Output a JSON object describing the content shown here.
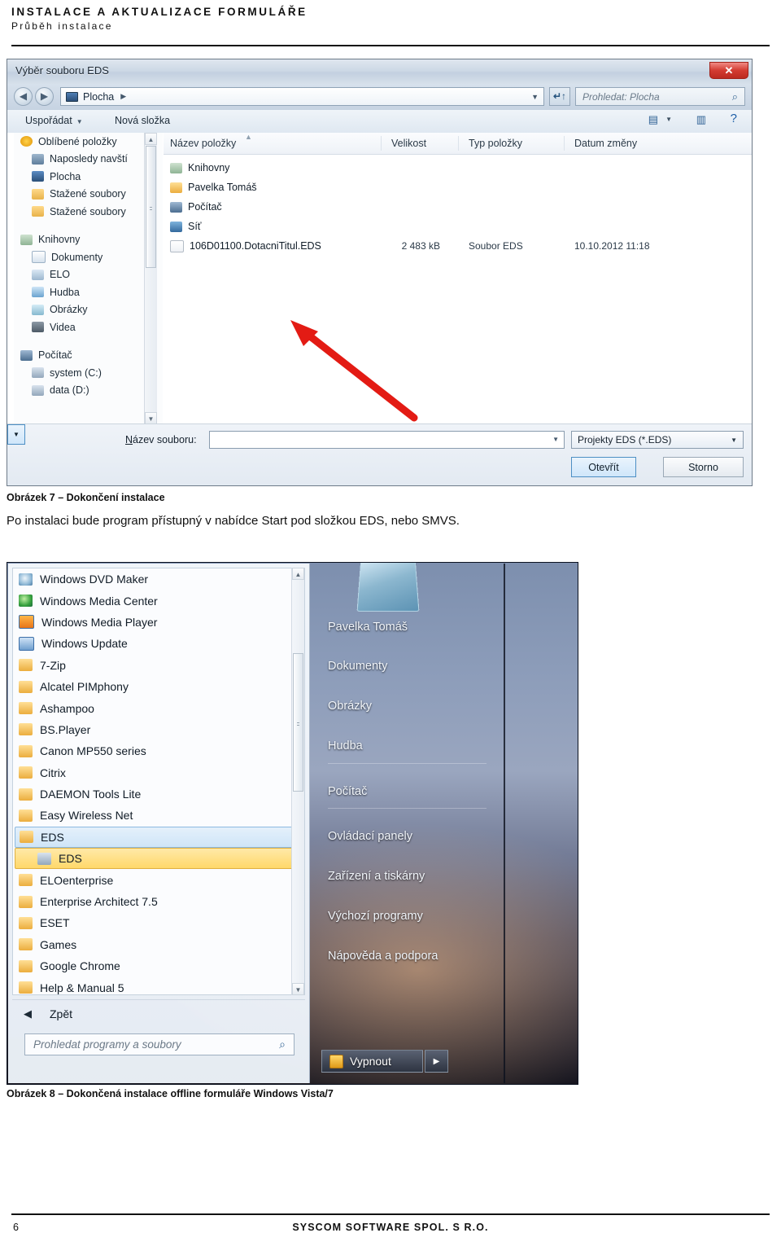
{
  "header": {
    "title": "INSTALACE A AKTUALIZACE FORMULÁŘE",
    "subtitle": "Průběh instalace"
  },
  "file_dialog": {
    "title": "Výběr souboru EDS",
    "close_label": "✕",
    "nav": {
      "back_icon": "◀",
      "forward_icon": "▶",
      "breadcrumb": "Plocha",
      "breadcrumb_arrow": "▶",
      "breadcrumb_caret": "▼",
      "refresh_icon": "↵↑",
      "search_placeholder": "Prohledat: Plocha",
      "search_icon": "⌕"
    },
    "toolbar": {
      "organize": "Uspořádat",
      "organize_caret": "▼",
      "new_folder": "Nová složka",
      "view_icon": "▤",
      "view_caret": "▼",
      "preview_icon": "▥",
      "help_icon": "?"
    },
    "sidebar": [
      {
        "label": "Oblíbené položky",
        "icon": "star-icon",
        "level": 0
      },
      {
        "label": "Naposledy navští",
        "icon": "recent-places-icon",
        "level": 1
      },
      {
        "label": "Plocha",
        "icon": "desktop-icon",
        "level": 1
      },
      {
        "label": "Stažené soubory",
        "icon": "downloads-icon",
        "level": 1
      },
      {
        "label": "Stažené soubory",
        "icon": "downloads-icon",
        "level": 1
      },
      {
        "label": "Knihovny",
        "icon": "libraries-icon",
        "level": 0
      },
      {
        "label": "Dokumenty",
        "icon": "documents-icon",
        "level": 1
      },
      {
        "label": "ELO",
        "icon": "elo-icon",
        "level": 1
      },
      {
        "label": "Hudba",
        "icon": "music-icon",
        "level": 1
      },
      {
        "label": "Obrázky",
        "icon": "pictures-icon",
        "level": 1
      },
      {
        "label": "Videa",
        "icon": "videos-icon",
        "level": 1
      },
      {
        "label": "Počítač",
        "icon": "computer-icon",
        "level": 0
      },
      {
        "label": "system (C:)",
        "icon": "drive-icon",
        "level": 1
      },
      {
        "label": "data (D:)",
        "icon": "drive-icon",
        "level": 1
      }
    ],
    "columns": [
      "Název položky",
      "Velikost",
      "Typ položky",
      "Datum změny"
    ],
    "rows": [
      {
        "name": "Knihovny",
        "icon": "libraries-icon",
        "size": "",
        "type": "",
        "date": ""
      },
      {
        "name": "Pavelka Tomáš",
        "icon": "user-folder-icon",
        "size": "",
        "type": "",
        "date": ""
      },
      {
        "name": "Počítač",
        "icon": "computer-icon",
        "size": "",
        "type": "",
        "date": ""
      },
      {
        "name": "Síť",
        "icon": "network-icon",
        "size": "",
        "type": "",
        "date": ""
      },
      {
        "name": "106D01100.DotacniTitul.EDS",
        "icon": "file-icon",
        "size": "2 483 kB",
        "type": "Soubor EDS",
        "date": "10.10.2012 11:18"
      }
    ],
    "bottom": {
      "filename_label": "Název souboru:",
      "filename_value": "",
      "filter_value": "Projekty EDS (*.EDS)",
      "open_button": "Otevřít",
      "open_caret": "▼",
      "cancel_button": "Storno"
    },
    "annotation": {
      "arrow_color": "#e31b14"
    }
  },
  "figure7_caption": "Obrázek 7 – Dokončení instalace",
  "body_text": "Po instalaci bude program přístupný v nabídce Start pod složkou EDS, nebo SMVS.",
  "start_menu": {
    "programs": [
      {
        "label": "Windows DVD Maker",
        "icon": "dvd-maker-icon",
        "state": "normal"
      },
      {
        "label": "Windows Media Center",
        "icon": "media-center-icon",
        "state": "normal"
      },
      {
        "label": "Windows Media Player",
        "icon": "media-player-icon",
        "state": "normal"
      },
      {
        "label": "Windows Update",
        "icon": "windows-update-icon",
        "state": "normal"
      },
      {
        "label": "7-Zip",
        "icon": "folder-icon",
        "state": "normal"
      },
      {
        "label": "Alcatel PIMphony",
        "icon": "folder-icon",
        "state": "normal"
      },
      {
        "label": "Ashampoo",
        "icon": "folder-icon",
        "state": "normal"
      },
      {
        "label": "BS.Player",
        "icon": "folder-icon",
        "state": "normal"
      },
      {
        "label": "Canon MP550 series",
        "icon": "folder-icon",
        "state": "normal"
      },
      {
        "label": "Citrix",
        "icon": "folder-icon",
        "state": "normal"
      },
      {
        "label": "DAEMON Tools Lite",
        "icon": "folder-icon",
        "state": "normal"
      },
      {
        "label": "Easy Wireless Net",
        "icon": "folder-icon",
        "state": "normal"
      },
      {
        "label": "EDS",
        "icon": "folder-icon",
        "state": "selected"
      },
      {
        "label": "EDS",
        "icon": "eds-app-icon",
        "state": "highlighted"
      },
      {
        "label": "ELOenterprise",
        "icon": "folder-icon",
        "state": "normal"
      },
      {
        "label": "Enterprise Architect 7.5",
        "icon": "folder-icon",
        "state": "normal"
      },
      {
        "label": "ESET",
        "icon": "folder-icon",
        "state": "normal"
      },
      {
        "label": "Games",
        "icon": "folder-icon",
        "state": "normal"
      },
      {
        "label": "Google Chrome",
        "icon": "folder-icon",
        "state": "normal"
      },
      {
        "label": "Help & Manual 5",
        "icon": "folder-icon",
        "state": "normal"
      }
    ],
    "back_label": "Zpět",
    "back_icon": "◀",
    "search_placeholder": "Prohledat programy a soubory",
    "search_icon": "⌕",
    "right_items": [
      "Pavelka Tomáš",
      "Dokumenty",
      "Obrázky",
      "Hudba",
      "Počítač",
      "Ovládací panely",
      "Zařízení a tiskárny",
      "Výchozí programy",
      "Nápověda a podpora"
    ],
    "shutdown_label": "Vypnout",
    "shutdown_caret": "▶"
  },
  "figure8_caption": "Obrázek 8 – Dokončená instalace offline formuláře Windows Vista/7",
  "footer": {
    "page_number": "6",
    "company": "SYSCOM SOFTWARE SPOL. S R.O."
  }
}
